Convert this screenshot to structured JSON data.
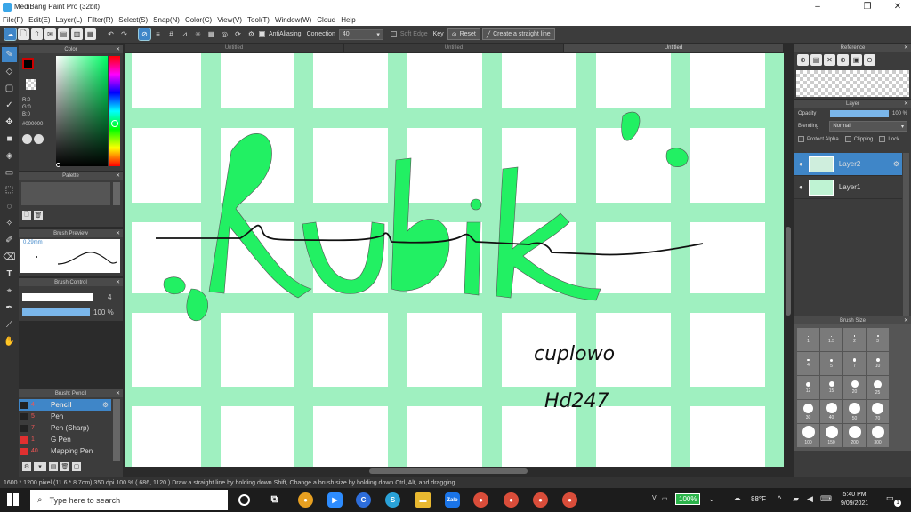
{
  "window": {
    "title": "MediBang Paint Pro (32bit)",
    "minimize": "–",
    "maximize": "❐",
    "close": "✕"
  },
  "menu": [
    "File(F)",
    "Edit(E)",
    "Layer(L)",
    "Filter(R)",
    "Select(S)",
    "Snap(N)",
    "Color(C)",
    "View(V)",
    "Tool(T)",
    "Window(W)",
    "Cloud",
    "Help"
  ],
  "toolbar": {
    "antialiasing_label": "AntiAliasing",
    "correction_label": "Correction",
    "correction_value": "40",
    "soft_edge_label": "Soft Edge",
    "key_label": "Key",
    "reset_label": "Reset",
    "straight_line_label": "Create a straight line"
  },
  "tabs": [
    "Untitled",
    "Untitled",
    "Untitled"
  ],
  "color_panel": {
    "title": "Color",
    "r": "R:0",
    "g": "G:0",
    "b": "B:0",
    "hex": "#000000",
    "primary_color": "#000000"
  },
  "palette_panel": {
    "title": "Palette"
  },
  "brush_preview": {
    "title": "Brush Preview",
    "size": "0.29mm"
  },
  "brush_control": {
    "title": "Brush Control",
    "size_value": "4",
    "opacity_value": "100 %"
  },
  "brush_list": {
    "title": "Brush: Pencil",
    "items": [
      {
        "num": "4",
        "name": "Pencil",
        "color": "#222222",
        "selected": true
      },
      {
        "num": "5",
        "name": "Pen",
        "color": "#222222",
        "selected": false
      },
      {
        "num": "7",
        "name": "Pen (Sharp)",
        "color": "#222222",
        "selected": false
      },
      {
        "num": "1",
        "name": "G Pen",
        "color": "#e03030",
        "selected": false
      },
      {
        "num": "40",
        "name": "Mapping Pen",
        "color": "#e03030",
        "selected": false
      }
    ]
  },
  "reference_panel": {
    "title": "Reference"
  },
  "layer_panel": {
    "title": "Layer",
    "opacity_label": "Opacity",
    "opacity_value": "100 %",
    "opacity_fraction": 1.0,
    "blending_label": "Blending",
    "blending_value": "Normal",
    "protect_alpha": "Protect Alpha",
    "clipping": "Clipping",
    "lock": "Lock",
    "layers": [
      {
        "name": "Layer2",
        "selected": true
      },
      {
        "name": "Layer1",
        "selected": false
      }
    ]
  },
  "brush_size_panel": {
    "title": "Brush Size",
    "sizes": [
      "1",
      "1.5",
      "2",
      "3",
      "4",
      "5",
      "7",
      "10",
      "12",
      "15",
      "20",
      "25",
      "30",
      "40",
      "50",
      "70",
      "100",
      "150",
      "200",
      "300"
    ]
  },
  "canvas": {
    "handwriting_1": "cuplowo",
    "handwriting_2": "Hd247",
    "grid_color": "#9ff0c0",
    "lettering_color": "#22f063"
  },
  "status": "1600 * 1200 pixel   (11.6 * 8.7cm)   350 dpi   100 %   ( 686, 1120 )   Draw a straight line by holding down Shift, Change a brush size by holding down Ctrl, Alt, and dragging",
  "taskbar": {
    "search_placeholder": "Type here to search",
    "battery": "100%",
    "weather": "88°F",
    "time": "5:40 PM",
    "date": "9/09/2021",
    "notification_count": "1",
    "lang": "VI"
  }
}
